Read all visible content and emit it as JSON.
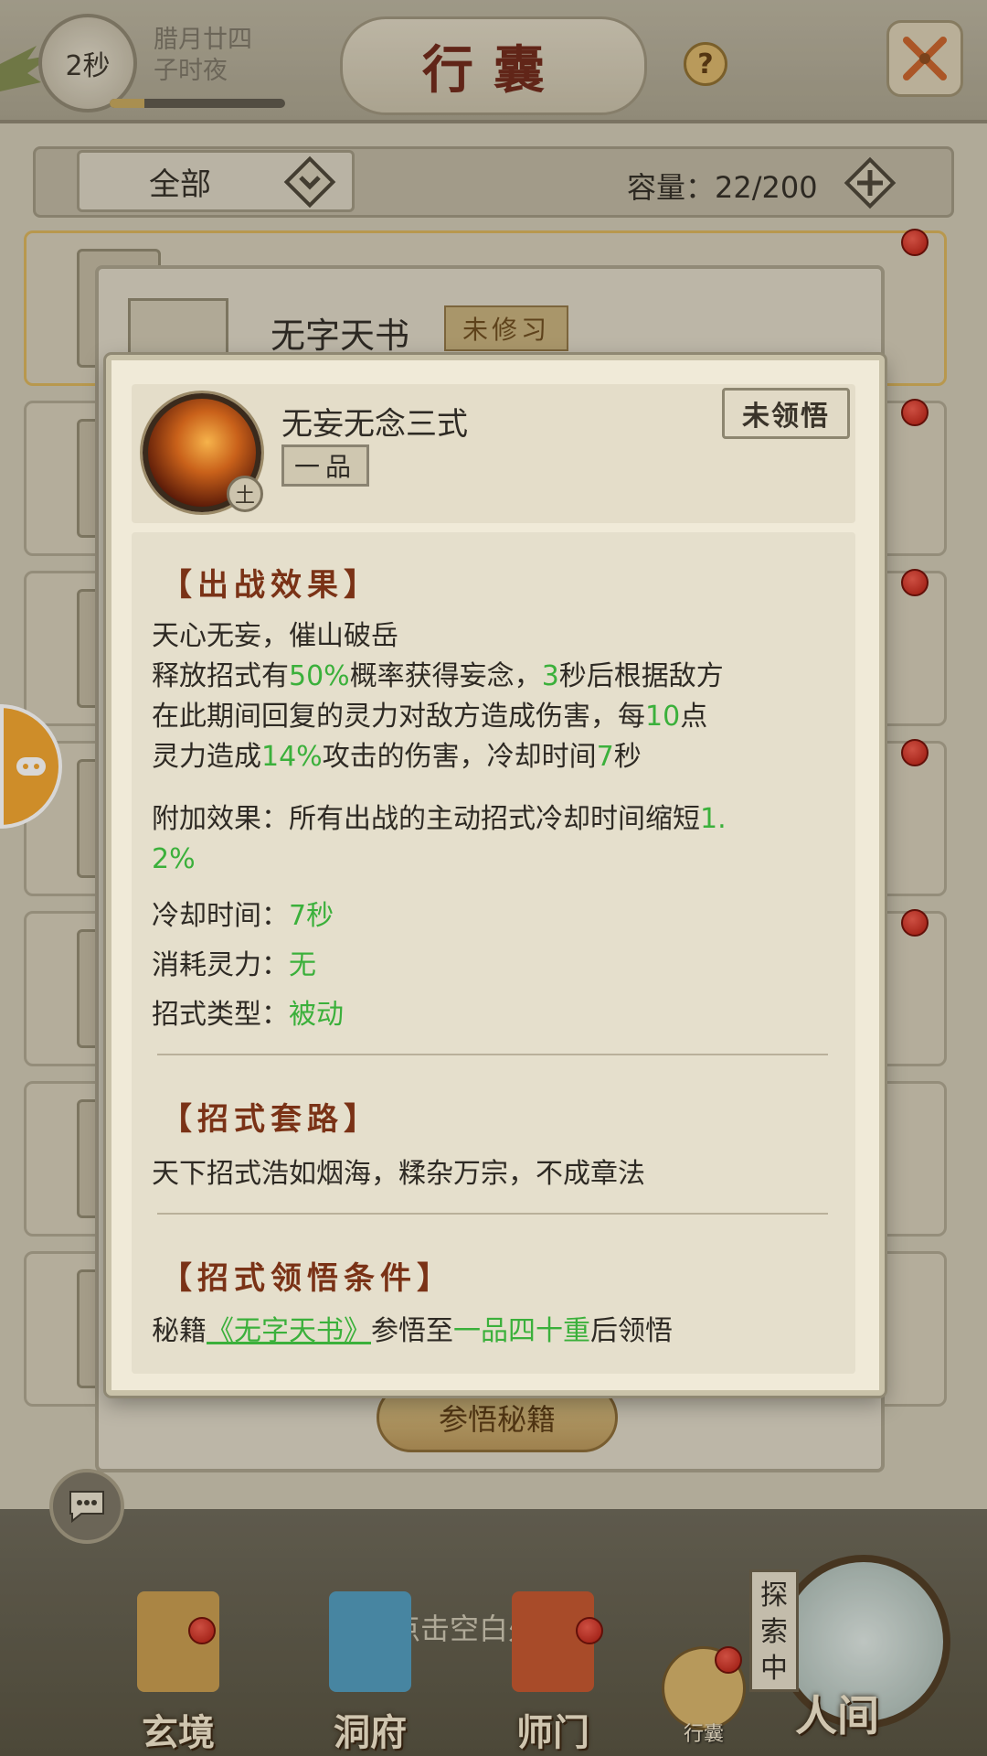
{
  "header": {
    "timer": "2秒",
    "date_line1": "腊月廿四",
    "date_line2": "子时夜",
    "timer_progress": 0.2,
    "title": "行囊",
    "help_symbol": "?",
    "close_icon": "close-x-icon"
  },
  "filter": {
    "category": "全部",
    "capacity_label": "容量：22/200"
  },
  "item_dialog": {
    "title": "无字天书",
    "badge": "未修习",
    "button": "参悟秘籍"
  },
  "skill_card": {
    "name": "无妄无念三式",
    "grade": "一品",
    "element": "土",
    "status": "未领悟",
    "sections": {
      "battle_title": "【出战效果】",
      "battle_lines": {
        "l1": "天心无妄，催山破岳",
        "l2a": "释放招式有",
        "l2b": "50%",
        "l2c": "概率获得妄念，",
        "l2d": "3",
        "l2e": "秒后根据敌方",
        "l3a": "在此期间回复的灵力对敌方造成伤害，每",
        "l3b": "10",
        "l3c": "点",
        "l4a": "灵力造成",
        "l4b": "14%",
        "l4c": "攻击的伤害，冷却时间",
        "l4d": "7",
        "l4e": "秒"
      },
      "extra_label": "附加效果：所有出战的主动招式冷却时间缩短",
      "extra_value_1": "1.",
      "extra_value_2": "2%",
      "cooldown_label": "冷却时间：",
      "cooldown_value": "7秒",
      "cost_label": "消耗灵力：",
      "cost_value": "无",
      "type_label": "招式类型：",
      "type_value": "被动",
      "routine_title": "【招式套路】",
      "routine_text": "天下招式浩如烟海，糅杂万宗，不成章法",
      "cond_title": "【招式领悟条件】",
      "cond_a": "秘籍",
      "cond_link": "《无字天书》",
      "cond_b": "参悟至",
      "cond_c": "一品四十重",
      "cond_d": "后领悟"
    }
  },
  "bottom": {
    "back_hint": "点击空白处返回",
    "nav": [
      "玄境",
      "洞府",
      "师门"
    ],
    "bag": "行囊",
    "explore": "探索中",
    "world": "人间"
  },
  "colors": {
    "accent_green": "#3bb03b",
    "section_title": "#7a3216",
    "notification_red": "#d42a1c"
  }
}
